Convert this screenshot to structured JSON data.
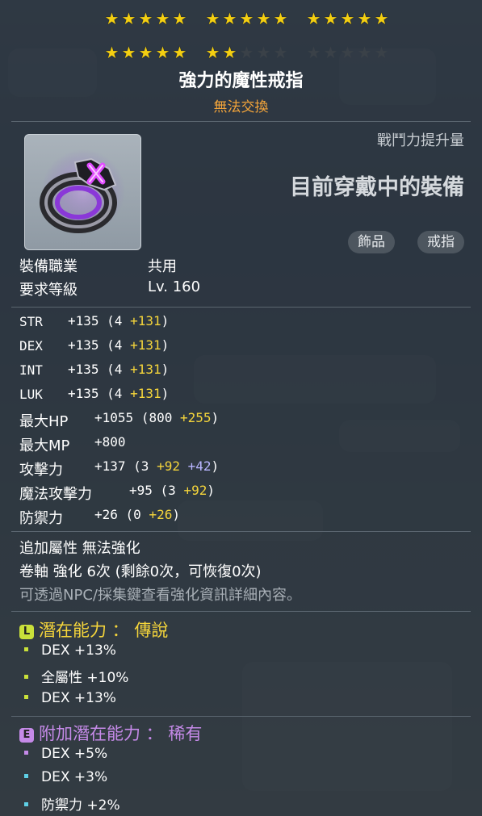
{
  "colors": {
    "star_on": "#f4cf12",
    "star_off": "#3a4148",
    "legendary": "#f5d53b",
    "legendary_badge": "#c9e03a",
    "unique_additional": "#c58ae8",
    "additional_badge": "#c58ae8",
    "bonus_yellow": "#f5d53b",
    "bonus_purple": "#b8b5ff",
    "untradeable": "#f3a43a"
  },
  "stars": {
    "total": 30,
    "filled": 22
  },
  "item": {
    "name": "強力的魔性戒指",
    "trade_status": "無法交換",
    "icon": "purple-ring-icon"
  },
  "power": {
    "label": "戰鬥力提升量",
    "current": "目前穿戴中的裝備"
  },
  "tags": [
    "飾品",
    "戒指"
  ],
  "req": {
    "job_label": "裝備職業",
    "job_value": "共用",
    "level_label": "要求等級",
    "level_value": "Lv. 160"
  },
  "stats": [
    {
      "name": "STR",
      "total": "+135",
      "base": "(4",
      "bonus": "+131",
      "extra": "",
      "close": ")"
    },
    {
      "name": "DEX",
      "total": "+135",
      "base": "(4",
      "bonus": "+131",
      "extra": "",
      "close": ")"
    },
    {
      "name": "INT",
      "total": "+135",
      "base": "(4",
      "bonus": "+131",
      "extra": "",
      "close": ")"
    },
    {
      "name": "LUK",
      "total": "+135",
      "base": "(4",
      "bonus": "+131",
      "extra": "",
      "close": ")"
    },
    {
      "name": "最大HP",
      "total": "+1055",
      "base": "(800",
      "bonus": "+255",
      "extra": "",
      "close": ")"
    },
    {
      "name": "最大MP",
      "total": "+800",
      "base": "",
      "bonus": "",
      "extra": "",
      "close": ""
    },
    {
      "name": "攻擊力",
      "total": "+137",
      "base": "(3",
      "bonus": "+92",
      "extra": "+42",
      "close": ")"
    },
    {
      "name": "魔法攻擊力",
      "total": "+95",
      "base": "(3",
      "bonus": "+92",
      "extra": "",
      "close": ")"
    },
    {
      "name": "防禦力",
      "total": "+26",
      "base": "(0",
      "bonus": "+26",
      "extra": "",
      "close": ")"
    }
  ],
  "enhance": {
    "additional": "追加屬性 無法強化",
    "scroll": "卷軸 強化 6次 (剩餘0次，可恢復0次)",
    "hint": "可透過NPC/採集鍵查看強化資訊詳細內容。"
  },
  "potential": {
    "badge": "L",
    "title": "潛在能力 ： 傳說",
    "lines": [
      "DEX +13%",
      "全屬性 +10%",
      "DEX +13%"
    ]
  },
  "additional_potential": {
    "badge": "E",
    "title": "附加潛在能力 ： 稀有",
    "lines": [
      "DEX +5%",
      "DEX +3%",
      "防禦力 +2%"
    ]
  }
}
